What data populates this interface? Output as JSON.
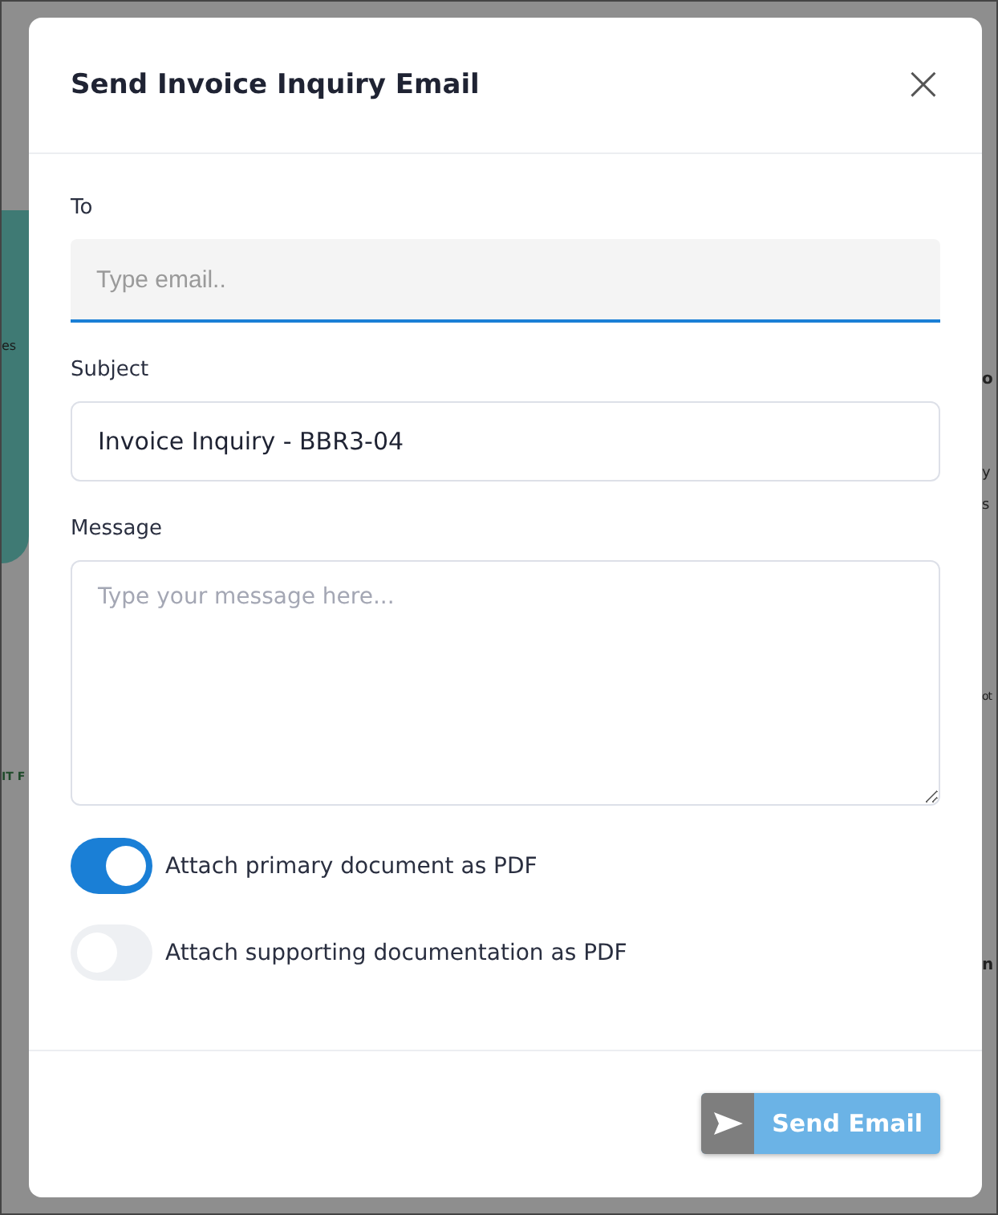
{
  "backdrop": {
    "left_texts": [
      "es",
      "IT F"
    ],
    "right_texts": [
      "o",
      "y",
      "s",
      "ot",
      "n"
    ]
  },
  "dialog": {
    "title": "Send Invoice Inquiry Email",
    "close": "×"
  },
  "fields": [
    {
      "kind": "email",
      "label": "To",
      "placeholder": "Type email..",
      "focused": true
    },
    {
      "kind": "text",
      "label": "Subject",
      "value": "Invoice Inquiry - BBR3-04",
      "focused": false
    },
    {
      "kind": "textarea",
      "label": "Message",
      "placeholder": "Type your message here...",
      "focused": false
    }
  ],
  "toggles": [
    {
      "label": "Attach primary document as PDF",
      "on": true
    },
    {
      "label": "Attach supporting documentation as PDF",
      "on": false
    }
  ],
  "send_button": {
    "label": "Send Email",
    "disabled": true
  }
}
